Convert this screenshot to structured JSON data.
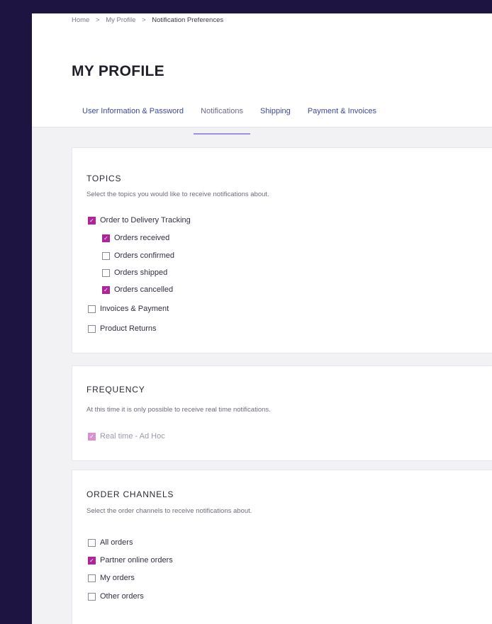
{
  "breadcrumb": {
    "home": "Home",
    "profile": "My Profile",
    "current": "Notification Preferences",
    "separator": ">"
  },
  "page_title": "MY PROFILE",
  "tabs": [
    {
      "label": "User Information & Password"
    },
    {
      "label": "Notifications"
    },
    {
      "label": "Shipping"
    },
    {
      "label": "Payment & Invoices"
    }
  ],
  "topics": {
    "heading": "TOPICS",
    "description": "Select the topics you would like to receive notifications about.",
    "items": [
      {
        "label": "Order to Delivery Tracking",
        "checked": true
      },
      {
        "label": "Orders received",
        "checked": true
      },
      {
        "label": "Orders confirmed",
        "checked": false
      },
      {
        "label": "Orders shipped",
        "checked": false
      },
      {
        "label": "Orders cancelled",
        "checked": true
      },
      {
        "label": "Invoices & Payment",
        "checked": false
      },
      {
        "label": "Product Returns",
        "checked": false
      }
    ]
  },
  "frequency": {
    "heading": "FREQUENCY",
    "description": "At this time it is only possible to receive real time notifications.",
    "items": [
      {
        "label": "Real time - Ad Hoc",
        "checked": true,
        "disabled": true
      }
    ]
  },
  "order_channels": {
    "heading": "ORDER CHANNELS",
    "description": "Select the order channels to receive notifications about.",
    "items": [
      {
        "label": "All orders",
        "checked": false
      },
      {
        "label": "Partner online orders",
        "checked": true
      },
      {
        "label": "My orders",
        "checked": false
      },
      {
        "label": "Other orders",
        "checked": false
      }
    ]
  },
  "colors": {
    "background": "#1d1442",
    "accent": "#b0249a",
    "link": "#3c4a9a"
  }
}
